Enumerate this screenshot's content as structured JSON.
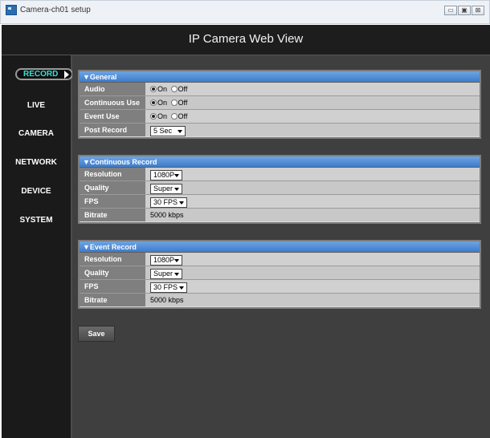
{
  "window": {
    "title": "Camera-ch01 setup",
    "controls": [
      "minimize-icon",
      "maximize-icon",
      "close-icon"
    ]
  },
  "header": {
    "title": "IP Camera Web View"
  },
  "sidebar": {
    "active": "RECORD",
    "items": [
      "LIVE",
      "CAMERA",
      "NETWORK",
      "DEVICE",
      "SYSTEM"
    ]
  },
  "general": {
    "title": "▼General",
    "rows": {
      "audio": {
        "label": "Audio",
        "on": "On",
        "off": "Off",
        "selected": "On"
      },
      "continuous": {
        "label": "Continuous Use",
        "on": "On",
        "off": "Off",
        "selected": "On"
      },
      "event": {
        "label": "Event Use",
        "on": "On",
        "off": "Off",
        "selected": "On"
      },
      "post": {
        "label": "Post Record",
        "value": "5 Sec"
      }
    }
  },
  "continuous_record": {
    "title": "▼Continuous Record",
    "resolution": {
      "label": "Resolution",
      "value": "1080P"
    },
    "quality": {
      "label": "Quality",
      "value": "Super"
    },
    "fps": {
      "label": "FPS",
      "value": "30 FPS"
    },
    "bitrate": {
      "label": "Bitrate",
      "value": "5000 kbps"
    }
  },
  "event_record": {
    "title": "▼Event Record",
    "resolution": {
      "label": "Resolution",
      "value": "1080P"
    },
    "quality": {
      "label": "Quality",
      "value": "Super"
    },
    "fps": {
      "label": "FPS",
      "value": "30 FPS"
    },
    "bitrate": {
      "label": "Bitrate",
      "value": "5000 kbps"
    }
  },
  "actions": {
    "save": "Save"
  },
  "colors": {
    "accent": "#37e0d2",
    "panel_header": "#4a86d4",
    "background": "#3f3f3f"
  }
}
